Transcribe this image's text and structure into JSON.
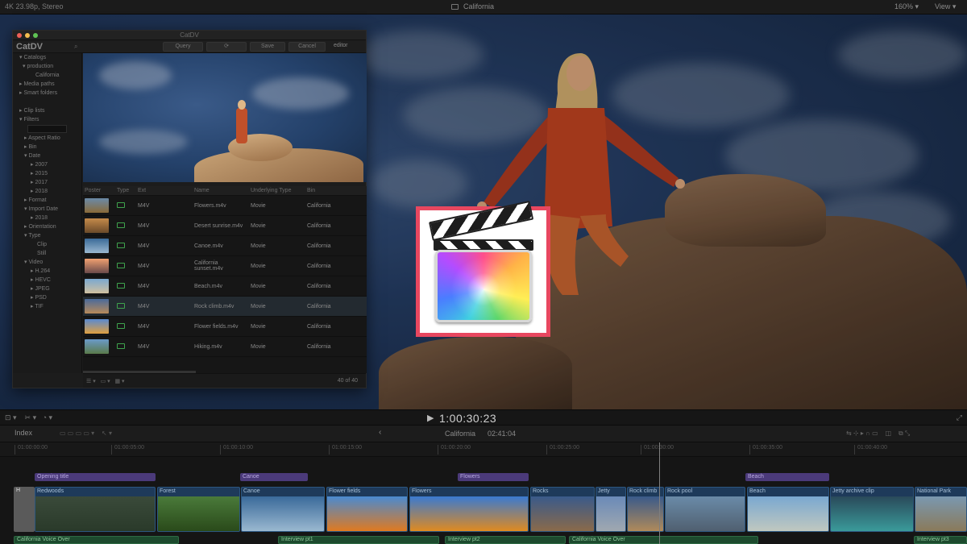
{
  "topbar": {
    "format": "4K 23.98p, Stereo",
    "project": "California",
    "zoom": "160%",
    "view": "View"
  },
  "catdv": {
    "window_title": "CatDV",
    "logo": "CatDV",
    "toolbar": {
      "query": "Query",
      "refresh": "⟳",
      "save": "Save",
      "cancel": "Cancel",
      "user": "editor"
    },
    "sidebar": [
      "▾ Catalogs",
      "▾ production",
      "California",
      "▸ Media paths",
      "▸ Smart folders",
      "",
      "▸ Clip lists",
      "▾ Filters",
      "",
      "▸ Aspect Ratio",
      "▸ Bin",
      "▾ Date",
      "▸ 2007",
      "▸ 2015",
      "▸ 2017",
      "▸ 2018",
      "▸ Format",
      "▾ Import Date",
      "▸ 2018",
      "▸ Orientation",
      "▾ Type",
      "Clip",
      "Still",
      "▾ Video",
      "▸ H.264",
      "▸ HEVC",
      "▸ JPEG",
      "▸ PSD",
      "▸ TIF"
    ],
    "columns": [
      "Poster",
      "Type",
      "Ext",
      "Name",
      "Underlying Type",
      "Bin"
    ],
    "rows": [
      {
        "ext": "M4V",
        "name": "Flowers.m4v",
        "under": "Movie",
        "bin": "California"
      },
      {
        "ext": "M4V",
        "name": "Desert sunrise.m4v",
        "under": "Movie",
        "bin": "California"
      },
      {
        "ext": "M4V",
        "name": "Canoe.m4v",
        "under": "Movie",
        "bin": "California"
      },
      {
        "ext": "M4V",
        "name": "California sunset.m4v",
        "under": "Movie",
        "bin": "California"
      },
      {
        "ext": "M4V",
        "name": "Beach.m4v",
        "under": "Movie",
        "bin": "California"
      },
      {
        "ext": "M4V",
        "name": "Rock climb.m4v",
        "under": "Movie",
        "bin": "California"
      },
      {
        "ext": "M4V",
        "name": "Flower fields.m4v",
        "under": "Movie",
        "bin": "California"
      },
      {
        "ext": "M4V",
        "name": "Hiking.m4v",
        "under": "Movie",
        "bin": "California"
      }
    ],
    "count": "40 of 40"
  },
  "transport": {
    "timecode": "1:00:30:23"
  },
  "timeline": {
    "index": "Index",
    "project": "California",
    "duration": "02:41:04",
    "ruler": [
      "01:00:00:00",
      "01:00:05:00",
      "01:00:10:00",
      "01:00:15:00",
      "01:00:20:00",
      "01:00:25:00",
      "01:00:30:00",
      "01:00:35:00",
      "01:00:40:00"
    ],
    "titles": [
      "Opening title",
      "Canoe",
      "Flowers",
      "Beach"
    ],
    "clips": [
      "Redwoods",
      "Forest",
      "Canoe",
      "Flower fields",
      "Flowers",
      "Rocks",
      "Jetty",
      "Rock climb",
      "Rock pool",
      "Beach",
      "Jetty archive clip",
      "National Park"
    ],
    "gap": "H",
    "audio": [
      "California Voice Over",
      "Interview pt1",
      "Interview pt2",
      "California Voice Over",
      "Interview pt3"
    ]
  },
  "colors": {
    "accent_frame": "#e8475f",
    "title_clip": "#4b3a7a",
    "video_clip": "#1e3a5a",
    "audio_clip": "#1d4a2e"
  }
}
